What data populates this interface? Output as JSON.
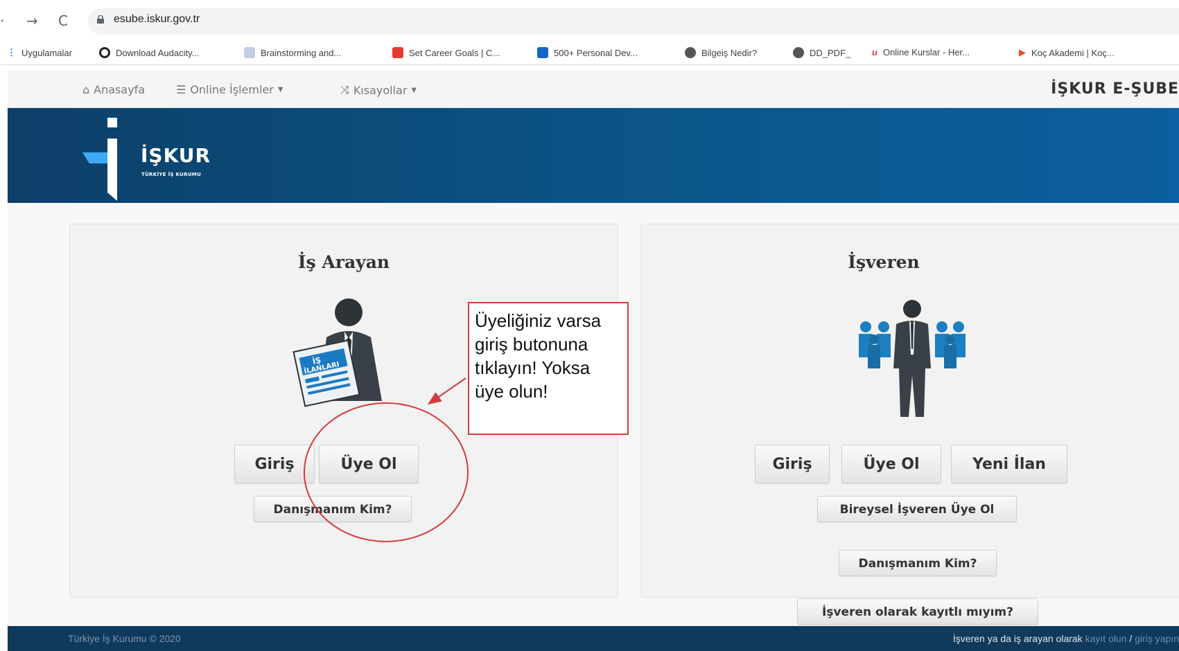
{
  "browser": {
    "back_icon": "back-arrow",
    "forward_icon": "forward-arrow",
    "reload_icon": "reload",
    "url": "esube.iskur.gov.tr",
    "bookmarks": [
      {
        "label": "Uygulamalar",
        "color": "#1a73e8"
      },
      {
        "label": "Download Audacity...",
        "color": "#222222"
      },
      {
        "label": "Brainstorming and...",
        "color": "#7c8fc7"
      },
      {
        "label": "Set Career Goals | C...",
        "color": "#e53935"
      },
      {
        "label": "500+ Personal Dev...",
        "color": "#1565c0"
      },
      {
        "label": "Bilgeiş Nedir?",
        "color": "#555555"
      },
      {
        "label": "DD_PDF_",
        "color": "#555555"
      },
      {
        "label": "Online Kurslar - Her...",
        "color": "#e53935"
      },
      {
        "label": "Koç Akademi | Koç...",
        "color": "#ef6c00"
      }
    ]
  },
  "site_nav": {
    "home": "Anasayfa",
    "online": "Online İşlemler",
    "shortcuts": "Kısayollar",
    "brand": "İŞKUR E-ŞUBE"
  },
  "banner": {
    "logo_text": "İŞKUR",
    "logo_sub": "TÜRKİYE İŞ KURUMU",
    "colors": {
      "start": "#0d3f68",
      "end": "#0c5fa0"
    }
  },
  "job_seeker": {
    "title": "İş Arayan",
    "newspaper_text_1": "İŞ",
    "newspaper_text_2": "İLANLARI",
    "login": "Giriş",
    "register": "Üye Ol",
    "advisor": "Danışmanım Kim?"
  },
  "employer": {
    "title": "İşveren",
    "login": "Giriş",
    "register": "Üye Ol",
    "new_listing": "Yeni İlan",
    "individual_register": "Bireysel İşveren Üye Ol",
    "advisor": "Danışmanım Kim?",
    "registered_check": "İşveren olarak kayıtlı mıyım?"
  },
  "annotation": {
    "line1": "Üyeliğiniz varsa",
    "line2": "giriş butonuna",
    "line3": "tıklayın! Yoksa",
    "line4": "üye olun!",
    "color": "#d23c3c"
  },
  "footer": {
    "copyright": "Türkiye İş Kurumu © 2020",
    "text": "İşveren ya da iş arayan olarak ",
    "link1": "kayıt olun",
    "sep": " / ",
    "link2": "giriş yapın"
  }
}
